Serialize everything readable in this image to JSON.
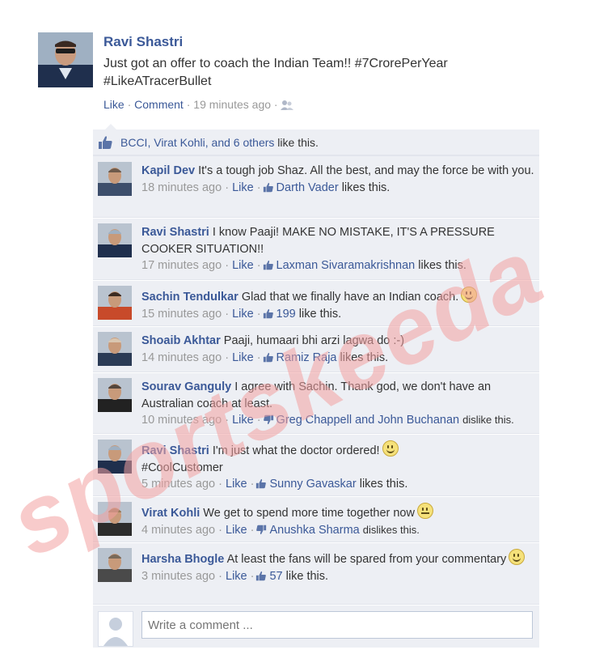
{
  "post": {
    "author": "Ravi Shastri",
    "text_line1": "Just got an offer to coach the Indian Team!! #7CrorePerYear",
    "text_line2": "#LikeATracerBullet",
    "like_label": "Like",
    "comment_label": "Comment",
    "timestamp": "19 minutes ago",
    "sep": "·"
  },
  "likes_summary": {
    "names": "BCCI, Virat Kohli, and 6 others",
    "suffix": "like this."
  },
  "comments": [
    {
      "author": "Kapil Dev",
      "text": "It's a tough job Shaz. All the best, and may the force be with you.",
      "time": "18 minutes ago",
      "like_label": "Like",
      "reaction": "like",
      "liker": "Darth Vader",
      "liker_suffix": "likes this."
    },
    {
      "author": "Ravi Shastri",
      "text": "I know Paaji! MAKE NO MISTAKE, IT'S A PRESSURE COOKER SITUATION!!",
      "time": "17 minutes ago",
      "like_label": "Like",
      "reaction": "like",
      "liker": "Laxman Sivaramakrishnan",
      "liker_suffix": "likes this."
    },
    {
      "author": "Sachin Tendulkar",
      "text": "Glad that we finally have an Indian coach.",
      "emoticon": "smile",
      "time": "15 minutes ago",
      "like_label": "Like",
      "reaction": "like",
      "liker": "199",
      "liker_suffix": "like this."
    },
    {
      "author": "Shoaib Akhtar",
      "text": "Paaji, humaari bhi arzi lagwa do :-)",
      "time": "14 minutes ago",
      "like_label": "Like",
      "reaction": "like",
      "liker": "Ramiz Raja",
      "liker_suffix": "likes this."
    },
    {
      "author": "Sourav Ganguly",
      "text": "I agree with Sachin. Thank god, we don't have an Australian coach at least.",
      "time": "10 minutes ago",
      "like_label": "Like",
      "reaction": "dislike",
      "liker": "Greg Chappell and John Buchanan",
      "liker_suffix": "dislike this."
    },
    {
      "author": "Ravi Shastri",
      "text": "I'm just what the doctor ordered!",
      "emoticon": "smile",
      "text_line2": "#CoolCustomer",
      "time": "5 minutes ago",
      "like_label": "Like",
      "reaction": "like",
      "liker": "Sunny Gavaskar",
      "liker_suffix": "likes this."
    },
    {
      "author": "Virat Kohli",
      "text": "We get to spend more time together now",
      "emoticon": "meh",
      "time": "4 minutes ago",
      "like_label": "Like",
      "reaction": "dislike",
      "liker": "Anushka Sharma",
      "liker_suffix": "dislikes this."
    },
    {
      "author": "Harsha Bhogle",
      "text": "At least the fans will be spared from your commentary",
      "emoticon": "smile",
      "time": "3 minutes ago",
      "like_label": "Like",
      "reaction": "like",
      "liker": "57",
      "liker_suffix": "like this."
    }
  ],
  "compose": {
    "placeholder": "Write a comment ..."
  },
  "watermark": "sportskeeda",
  "colors": {
    "link": "#3b5998",
    "meta": "#999999",
    "panel": "#edeff4",
    "watermark": "#f2a0a0"
  }
}
